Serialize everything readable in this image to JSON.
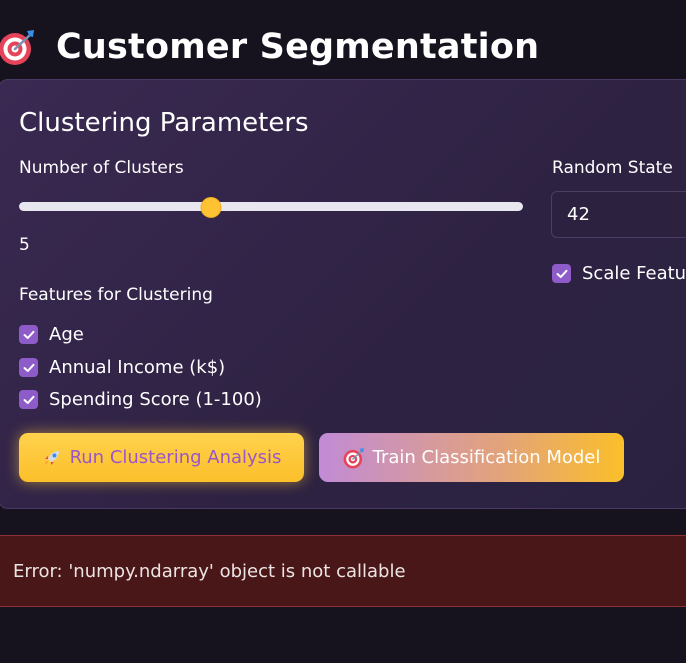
{
  "header": {
    "icon": "target-icon",
    "title": "Customer Segmentation"
  },
  "parameters": {
    "title": "Clustering Parameters",
    "clusters": {
      "label": "Number of Clusters",
      "value": "5",
      "level_fraction": 0.38
    },
    "random_state": {
      "label": "Random State",
      "value": "42"
    },
    "scale_features": {
      "label": "Scale Features",
      "checked": true
    },
    "features": {
      "label": "Features for Clustering",
      "items": [
        {
          "label": "Age",
          "checked": true
        },
        {
          "label": "Annual Income (k$)",
          "checked": true
        },
        {
          "label": "Spending Score (1-100)",
          "checked": true
        }
      ]
    },
    "buttons": {
      "run_label": "Run Clustering Analysis",
      "run_icon": "rocket-icon",
      "train_label": "Train Classification Model",
      "train_icon": "target-icon"
    }
  },
  "error": {
    "message": "Error: 'numpy.ndarray' object is not callable"
  },
  "colors": {
    "accent_yellow": "#fbbf2a",
    "checkbox_purple": "#8d5cc8",
    "error_bg": "#4a1718"
  }
}
